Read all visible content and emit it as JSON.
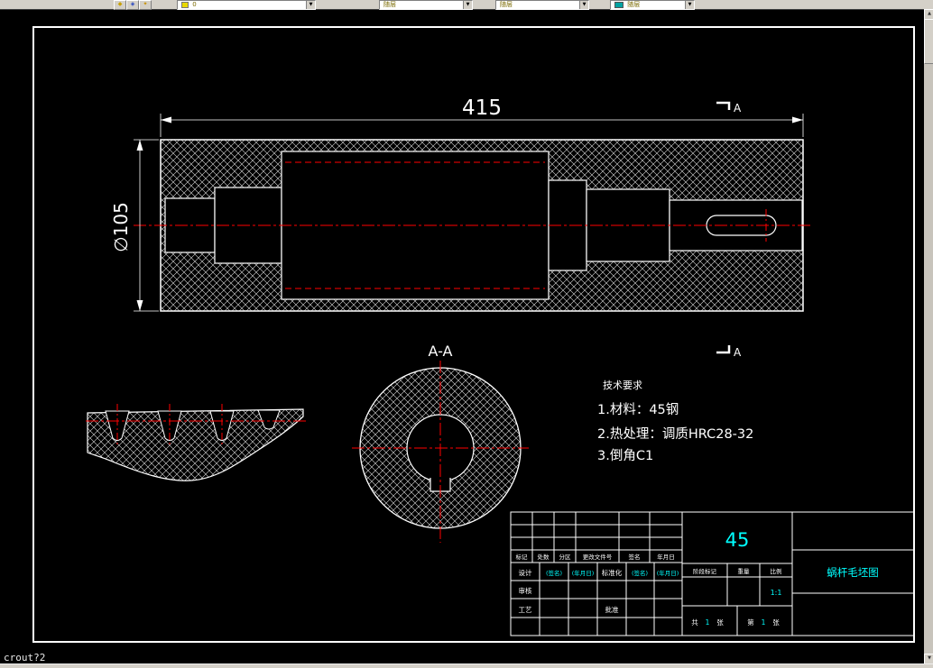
{
  "toolbar": {
    "layer_value": "0",
    "color_value": "随层",
    "linetype_value": "随层",
    "lineweight_value": "随层"
  },
  "command_line": {
    "text": "crout?2"
  },
  "drawing": {
    "dim_length": "415",
    "dim_diameter": "∅105",
    "section_mark": "A",
    "section_view_label": "A-A",
    "tech_req_title": "技术要求",
    "tech_req_1": "1.材料：45钢",
    "tech_req_2": "2.热处理：调质HRC28-32",
    "tech_req_3": "3.倒角C1"
  },
  "title_block": {
    "material": "45",
    "drawing_title": "蜗杆毛坯图",
    "col_mark": "标记",
    "col_count": "处数",
    "col_zone": "分区",
    "col_doc": "更改文件号",
    "col_sign": "签名",
    "col_date": "年月日",
    "row_design": "设计",
    "row_check": "审核",
    "row_process": "工艺",
    "row_std": "标准化",
    "row_approve": "批准",
    "sign_placeholder": "(签名)",
    "date_placeholder": "(年月日)",
    "stage_mark": "阶段标记",
    "weight": "重量",
    "scale": "比例",
    "scale_value": "1:1",
    "sheet_total_label": "共",
    "sheet_total_value": "1",
    "sheet_unit": "张",
    "sheet_index_label": "第",
    "sheet_index_value": "1"
  },
  "colors": {
    "background": "#000000",
    "line": "#ffffff",
    "centerline": "#ff0000",
    "accent": "#00ffff",
    "chrome": "#d4d0c8"
  }
}
